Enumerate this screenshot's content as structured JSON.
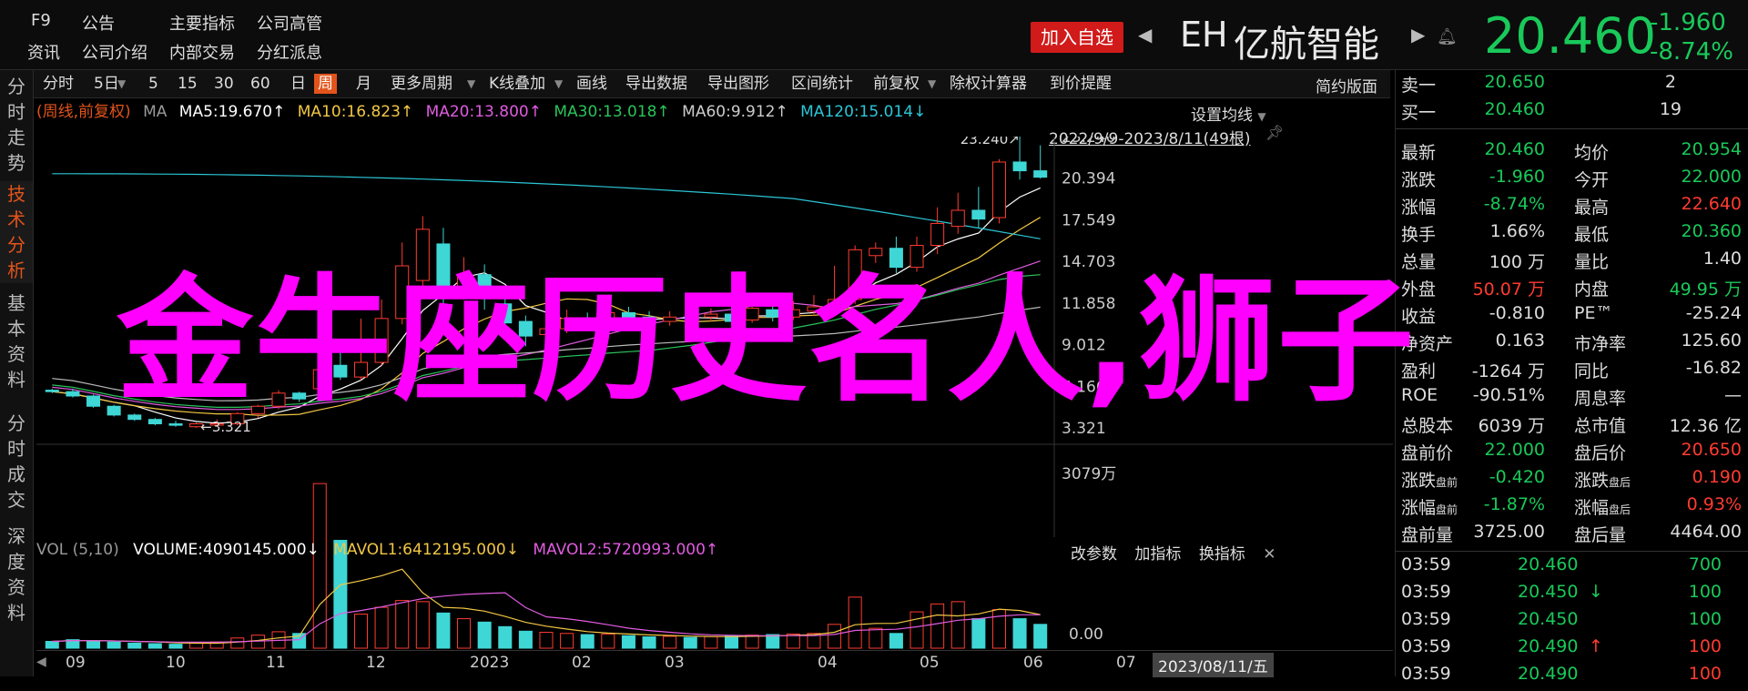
{
  "topmenu": {
    "f9": "F9",
    "notice": "公告",
    "main_index": "主要指标",
    "company_exec": "公司高管",
    "info": "资讯",
    "company_intro": "公司介绍",
    "insider_trade": "内部交易",
    "dividend": "分红派息"
  },
  "header": {
    "add_watch": "加入自选",
    "code": "EH",
    "name": "亿航智能",
    "price": "20.460",
    "change": "-1.960",
    "change_pct": "-8.74%"
  },
  "left_tabs": [
    "分时走势",
    "技术分析",
    "基本资料",
    "分时成交",
    "深度资料"
  ],
  "toolbar": {
    "items": [
      "分时",
      "5日",
      "5",
      "15",
      "30",
      "60",
      "日",
      "周",
      "月",
      "更多周期",
      "K线叠加",
      "画线",
      "导出数据",
      "导出图形",
      "区间统计",
      "前复权",
      "除权计算器",
      "到价提醒"
    ],
    "active": "周",
    "right": "简约版面"
  },
  "ma": {
    "mode": "(周线,前复权)",
    "ma_label": "MA",
    "items": [
      {
        "text": "MA5:19.670↑",
        "color": "#ffffff"
      },
      {
        "text": "MA10:16.823↑",
        "color": "#f2c744"
      },
      {
        "text": "MA20:13.800↑",
        "color": "#e05be0"
      },
      {
        "text": "MA30:13.018↑",
        "color": "#29c45a"
      },
      {
        "text": "MA60:9.912↑",
        "color": "#cccccc"
      },
      {
        "text": "MA120:15.014↓",
        "color": "#2bc6d6"
      }
    ],
    "set_avg": "设置均线",
    "range": "2022/9/9-2023/8/11(49根)"
  },
  "chart_data": {
    "type": "candlestick",
    "title": "",
    "y_ticks": [
      "23.240",
      "20.394",
      "17.549",
      "14.703",
      "11.858",
      "9.012",
      "6.166",
      "3.321"
    ],
    "ylim": [
      3.321,
      23.24
    ],
    "x_ticks": [
      "09",
      "10",
      "11",
      "12",
      "2023",
      "02",
      "03",
      "04",
      "05",
      "06",
      "07",
      "2023/08/11/五"
    ],
    "annotations": [
      "23.240",
      "3.321"
    ],
    "candles": [
      {
        "o": 5.9,
        "c": 5.8,
        "h": 6.0,
        "l": 5.7
      },
      {
        "o": 5.8,
        "c": 5.5,
        "h": 6.0,
        "l": 5.4
      },
      {
        "o": 5.5,
        "c": 4.8,
        "h": 5.6,
        "l": 4.7
      },
      {
        "o": 4.8,
        "c": 4.2,
        "h": 4.9,
        "l": 4.1
      },
      {
        "o": 4.2,
        "c": 3.9,
        "h": 4.3,
        "l": 3.8
      },
      {
        "o": 3.9,
        "c": 3.6,
        "h": 4.0,
        "l": 3.5
      },
      {
        "o": 3.6,
        "c": 3.5,
        "h": 3.8,
        "l": 3.4
      },
      {
        "o": 3.4,
        "c": 3.6,
        "h": 3.7,
        "l": 3.321
      },
      {
        "o": 3.6,
        "c": 3.6,
        "h": 3.9,
        "l": 3.4
      },
      {
        "o": 3.6,
        "c": 4.3,
        "h": 4.4,
        "l": 3.5
      },
      {
        "o": 4.3,
        "c": 4.8,
        "h": 4.9,
        "l": 4.0
      },
      {
        "o": 4.8,
        "c": 5.7,
        "h": 5.9,
        "l": 4.6
      },
      {
        "o": 5.7,
        "c": 5.3,
        "h": 5.8,
        "l": 5.1
      },
      {
        "o": 6.0,
        "c": 7.3,
        "h": 8.6,
        "l": 5.8
      },
      {
        "o": 7.6,
        "c": 6.8,
        "h": 9.4,
        "l": 6.6
      },
      {
        "o": 6.8,
        "c": 7.8,
        "h": 10.8,
        "l": 6.6
      },
      {
        "o": 7.8,
        "c": 10.8,
        "h": 12.1,
        "l": 7.6
      },
      {
        "o": 10.8,
        "c": 14.4,
        "h": 16.0,
        "l": 10.4
      },
      {
        "o": 13.4,
        "c": 16.9,
        "h": 17.8,
        "l": 12.6
      },
      {
        "o": 15.9,
        "c": 12.4,
        "h": 17.0,
        "l": 11.6
      },
      {
        "o": 12.6,
        "c": 13.6,
        "h": 15.0,
        "l": 12.1
      },
      {
        "o": 13.8,
        "c": 12.3,
        "h": 14.5,
        "l": 11.4
      },
      {
        "o": 11.8,
        "c": 10.5,
        "h": 12.4,
        "l": 9.6
      },
      {
        "o": 10.6,
        "c": 9.6,
        "h": 11.0,
        "l": 8.9
      },
      {
        "o": 9.7,
        "c": 10.1,
        "h": 10.8,
        "l": 9.3
      },
      {
        "o": 10.1,
        "c": 10.8,
        "h": 11.4,
        "l": 9.8
      },
      {
        "o": 10.8,
        "c": 10.4,
        "h": 11.2,
        "l": 10.0
      },
      {
        "o": 10.5,
        "c": 11.2,
        "h": 11.8,
        "l": 10.2
      },
      {
        "o": 11.2,
        "c": 10.9,
        "h": 11.6,
        "l": 10.6
      },
      {
        "o": 10.9,
        "c": 10.5,
        "h": 11.3,
        "l": 10.2
      },
      {
        "o": 10.6,
        "c": 10.9,
        "h": 11.3,
        "l": 10.3
      },
      {
        "o": 10.9,
        "c": 10.8,
        "h": 11.3,
        "l": 10.5
      },
      {
        "o": 10.9,
        "c": 11.1,
        "h": 11.5,
        "l": 10.6
      },
      {
        "o": 11.1,
        "c": 10.6,
        "h": 11.6,
        "l": 10.4
      },
      {
        "o": 10.7,
        "c": 11.5,
        "h": 12.0,
        "l": 10.5
      },
      {
        "o": 11.4,
        "c": 10.9,
        "h": 11.8,
        "l": 10.6
      },
      {
        "o": 10.9,
        "c": 11.4,
        "h": 12.0,
        "l": 10.7
      },
      {
        "o": 11.3,
        "c": 11.6,
        "h": 12.4,
        "l": 11.0
      },
      {
        "o": 11.6,
        "c": 12.1,
        "h": 14.4,
        "l": 11.3
      },
      {
        "o": 12.1,
        "c": 15.5,
        "h": 15.8,
        "l": 11.8
      },
      {
        "o": 15.1,
        "c": 15.6,
        "h": 16.0,
        "l": 14.6
      },
      {
        "o": 15.6,
        "c": 14.3,
        "h": 16.4,
        "l": 13.9
      },
      {
        "o": 14.3,
        "c": 15.8,
        "h": 16.4,
        "l": 14.0
      },
      {
        "o": 15.8,
        "c": 17.3,
        "h": 18.4,
        "l": 15.2
      },
      {
        "o": 17.1,
        "c": 18.2,
        "h": 19.4,
        "l": 16.6
      },
      {
        "o": 18.2,
        "c": 17.6,
        "h": 19.8,
        "l": 17.0
      },
      {
        "o": 17.7,
        "c": 21.5,
        "h": 21.7,
        "l": 17.3
      },
      {
        "o": 21.5,
        "c": 20.9,
        "h": 23.24,
        "l": 20.3
      },
      {
        "o": 20.9,
        "c": 20.46,
        "h": 22.64,
        "l": 20.36
      }
    ],
    "volume_max_label": "3079万",
    "volume_zero_label": "0.00",
    "volume": [
      120,
      150,
      130,
      110,
      90,
      80,
      70,
      95,
      110,
      180,
      230,
      290,
      260,
      2900,
      1900,
      600,
      720,
      840,
      820,
      620,
      520,
      460,
      380,
      300,
      280,
      260,
      240,
      250,
      220,
      200,
      210,
      190,
      205,
      215,
      230,
      240,
      250,
      260,
      420,
      900,
      350,
      260,
      640,
      780,
      820,
      520,
      680,
      520,
      420
    ]
  },
  "vol": {
    "label": "VOL (5,10)",
    "volume": "VOLUME:4090145.000↓",
    "mavol1": "MAVOL1:6412195.000↓",
    "mavol2": "MAVOL2:5720993.000↑",
    "edit": "改参数",
    "add": "加指标",
    "switch": "换指标"
  },
  "panel": {
    "sell1": {
      "label": "卖一",
      "price": "20.650",
      "vol": "2"
    },
    "buy1": {
      "label": "买一",
      "price": "20.460",
      "vol": "19"
    },
    "rows": [
      {
        "l1": "最新",
        "v1": "20.460",
        "c1": "g",
        "l2": "均价",
        "v2": "20.954",
        "c2": "g"
      },
      {
        "l1": "涨跌",
        "v1": "-1.960",
        "c1": "g",
        "l2": "今开",
        "v2": "22.000",
        "c2": "g"
      },
      {
        "l1": "涨幅",
        "v1": "-8.74%",
        "c1": "g",
        "l2": "最高",
        "v2": "22.640",
        "c2": "r"
      },
      {
        "l1": "换手",
        "v1": "1.66%",
        "c1": "w",
        "l2": "最低",
        "v2": "20.360",
        "c2": "g"
      },
      {
        "l1": "总量",
        "v1": "100 万",
        "c1": "w",
        "l2": "量比",
        "v2": "1.40",
        "c2": "w"
      },
      {
        "l1": "外盘",
        "v1": "50.07 万",
        "c1": "r",
        "l2": "内盘",
        "v2": "49.95 万",
        "c2": "g"
      },
      {
        "l1": "收益",
        "v1": "-0.810",
        "c1": "w",
        "l2": "PE™",
        "v2": "-25.24",
        "c2": "w"
      },
      {
        "l1": "净资产",
        "v1": "0.163",
        "c1": "w",
        "l2": "市净率",
        "v2": "125.60",
        "c2": "w"
      },
      {
        "l1": "盈利",
        "v1": "-1264 万",
        "c1": "w",
        "l2": "同比",
        "v2": "-16.82",
        "c2": "w"
      },
      {
        "l1": "ROE",
        "v1": "-90.51%",
        "c1": "w",
        "l2": "周息率",
        "v2": "—",
        "c2": "w"
      },
      {
        "l1": "总股本",
        "v1": "6039 万",
        "c1": "w",
        "l2": "总市值",
        "v2": "12.36 亿",
        "c2": "w"
      },
      {
        "l1": "盘前价",
        "v1": "22.000",
        "c1": "g",
        "l2": "盘后价",
        "v2": "20.650",
        "c2": "r"
      },
      {
        "l1": "涨跌",
        "l1sub": "盘前",
        "v1": "-0.420",
        "c1": "g",
        "l2": "涨跌",
        "l2sub": "盘后",
        "v2": "0.190",
        "c2": "r"
      },
      {
        "l1": "涨幅",
        "l1sub": "盘前",
        "v1": "-1.87%",
        "c1": "g",
        "l2": "涨幅",
        "l2sub": "盘后",
        "v2": "0.93%",
        "c2": "r"
      },
      {
        "l1": "盘前量",
        "v1": "3725.00",
        "c1": "w",
        "l2": "盘后量",
        "v2": "4464.00",
        "c2": "w"
      }
    ],
    "trades": [
      {
        "time": "03:59",
        "price": "20.460",
        "arrow": "",
        "vol": "700",
        "vc": "g"
      },
      {
        "time": "03:59",
        "price": "20.450",
        "arrow": "↓",
        "vol": "100",
        "vc": "g"
      },
      {
        "time": "03:59",
        "price": "20.450",
        "arrow": "",
        "vol": "100",
        "vc": "g"
      },
      {
        "time": "03:59",
        "price": "20.490",
        "arrow": "↑",
        "vol": "100",
        "vc": "r"
      },
      {
        "time": "03:59",
        "price": "20.490",
        "arrow": "",
        "vol": "100",
        "vc": "r"
      }
    ]
  },
  "overlay_text": "金牛座历史名人,狮子"
}
